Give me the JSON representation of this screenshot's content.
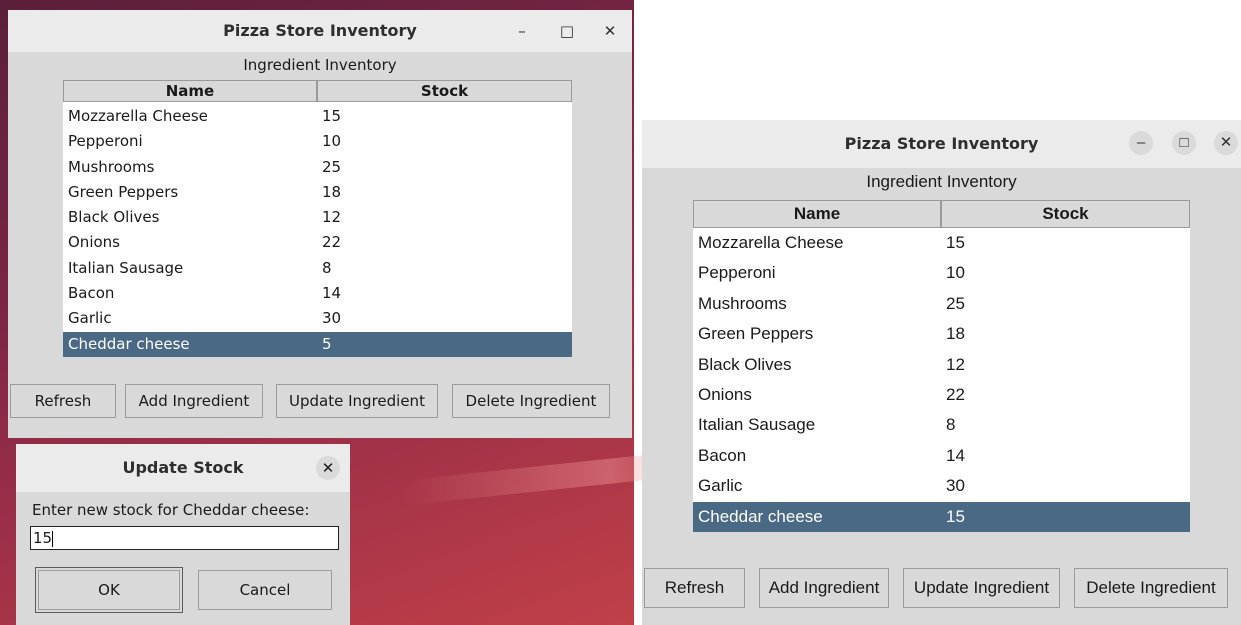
{
  "left_window": {
    "title": "Pizza Store Inventory",
    "controls": {
      "minimize": "–",
      "maximize": "□",
      "close": "✕"
    },
    "caption": "Ingredient Inventory",
    "columns": [
      "Name",
      "Stock"
    ],
    "rows": [
      {
        "name": "Mozzarella Cheese",
        "stock": "15"
      },
      {
        "name": "Pepperoni",
        "stock": "10"
      },
      {
        "name": "Mushrooms",
        "stock": "25"
      },
      {
        "name": "Green Peppers",
        "stock": "18"
      },
      {
        "name": "Black Olives",
        "stock": "12"
      },
      {
        "name": "Onions",
        "stock": "22"
      },
      {
        "name": "Italian Sausage",
        "stock": "8"
      },
      {
        "name": "Bacon",
        "stock": "14"
      },
      {
        "name": "Garlic",
        "stock": "30"
      },
      {
        "name": "Cheddar cheese",
        "stock": "5",
        "selected": true
      }
    ],
    "buttons": [
      "Refresh",
      "Add Ingredient",
      "Update Ingredient",
      "Delete Ingredient"
    ]
  },
  "dialog": {
    "title": "Update Stock",
    "close": "✕",
    "prompt": "Enter new stock for Cheddar cheese:",
    "input_value": "15",
    "ok": "OK",
    "cancel": "Cancel"
  },
  "right_window": {
    "title": "Pizza Store Inventory",
    "controls": {
      "minimize": "–",
      "maximize": "□",
      "close": "✕"
    },
    "caption": "Ingredient Inventory",
    "columns": [
      "Name",
      "Stock"
    ],
    "rows": [
      {
        "name": "Mozzarella Cheese",
        "stock": "15"
      },
      {
        "name": "Pepperoni",
        "stock": "10"
      },
      {
        "name": "Mushrooms",
        "stock": "25"
      },
      {
        "name": "Green Peppers",
        "stock": "18"
      },
      {
        "name": "Black Olives",
        "stock": "12"
      },
      {
        "name": "Onions",
        "stock": "22"
      },
      {
        "name": "Italian Sausage",
        "stock": "8"
      },
      {
        "name": "Bacon",
        "stock": "14"
      },
      {
        "name": "Garlic",
        "stock": "30"
      },
      {
        "name": "Cheddar cheese",
        "stock": "15",
        "selected": true
      }
    ],
    "buttons": [
      "Refresh",
      "Add Ingredient",
      "Update Ingredient",
      "Delete Ingredient"
    ]
  },
  "colors": {
    "selection": "#4a6984",
    "window_bg": "#d9d9d9",
    "titlebar_bg": "#ebebeb"
  }
}
